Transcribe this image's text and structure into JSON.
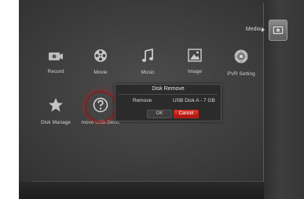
{
  "header": {
    "section_label": "Media"
  },
  "menu": {
    "row1": [
      {
        "label": "Record",
        "icon": "camera-icon"
      },
      {
        "label": "Movie",
        "icon": "film-reel-icon"
      },
      {
        "label": "Music",
        "icon": "music-note-icon"
      },
      {
        "label": "Image",
        "icon": "picture-icon"
      },
      {
        "label": "PVR Setting",
        "icon": "disc-gear-icon"
      }
    ],
    "row2": [
      {
        "label": "Disk Manage",
        "icon": "star-icon"
      },
      {
        "label": "move USB Devic",
        "icon": "question-icon",
        "selected": true
      }
    ]
  },
  "dialog": {
    "title": "Disk Remove",
    "field_label": "Remove",
    "field_value": "USB Disk A - 7 GB",
    "ok_label": "OK",
    "cancel_label": "Cancel",
    "focused_button": "cancel"
  },
  "colors": {
    "background": "#3b3b3b",
    "cancel_button": "#d12a1f",
    "selection_ring": "#9a1616"
  }
}
